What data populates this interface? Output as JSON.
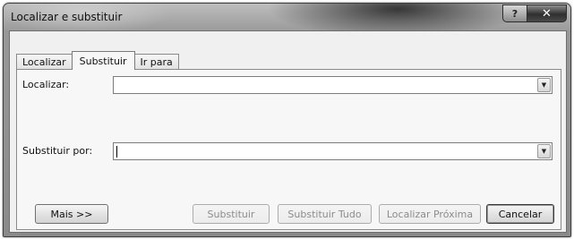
{
  "window": {
    "title": "Localizar e substituir",
    "help_label": "?",
    "close_label": "✕"
  },
  "tabs": [
    {
      "label": "Localizar",
      "active": false
    },
    {
      "label": "Substituir",
      "active": true
    },
    {
      "label": "Ir para",
      "active": false
    }
  ],
  "find": {
    "label": "Localizar:",
    "value": ""
  },
  "replace": {
    "label": "Substituir por:",
    "value": ""
  },
  "buttons": {
    "more": "Mais >>",
    "replace": "Substituir",
    "replace_all": "Substituir Tudo",
    "find_next": "Localizar Próxima",
    "cancel": "Cancelar"
  },
  "icons": {
    "dropdown": "chevron-down-icon"
  }
}
